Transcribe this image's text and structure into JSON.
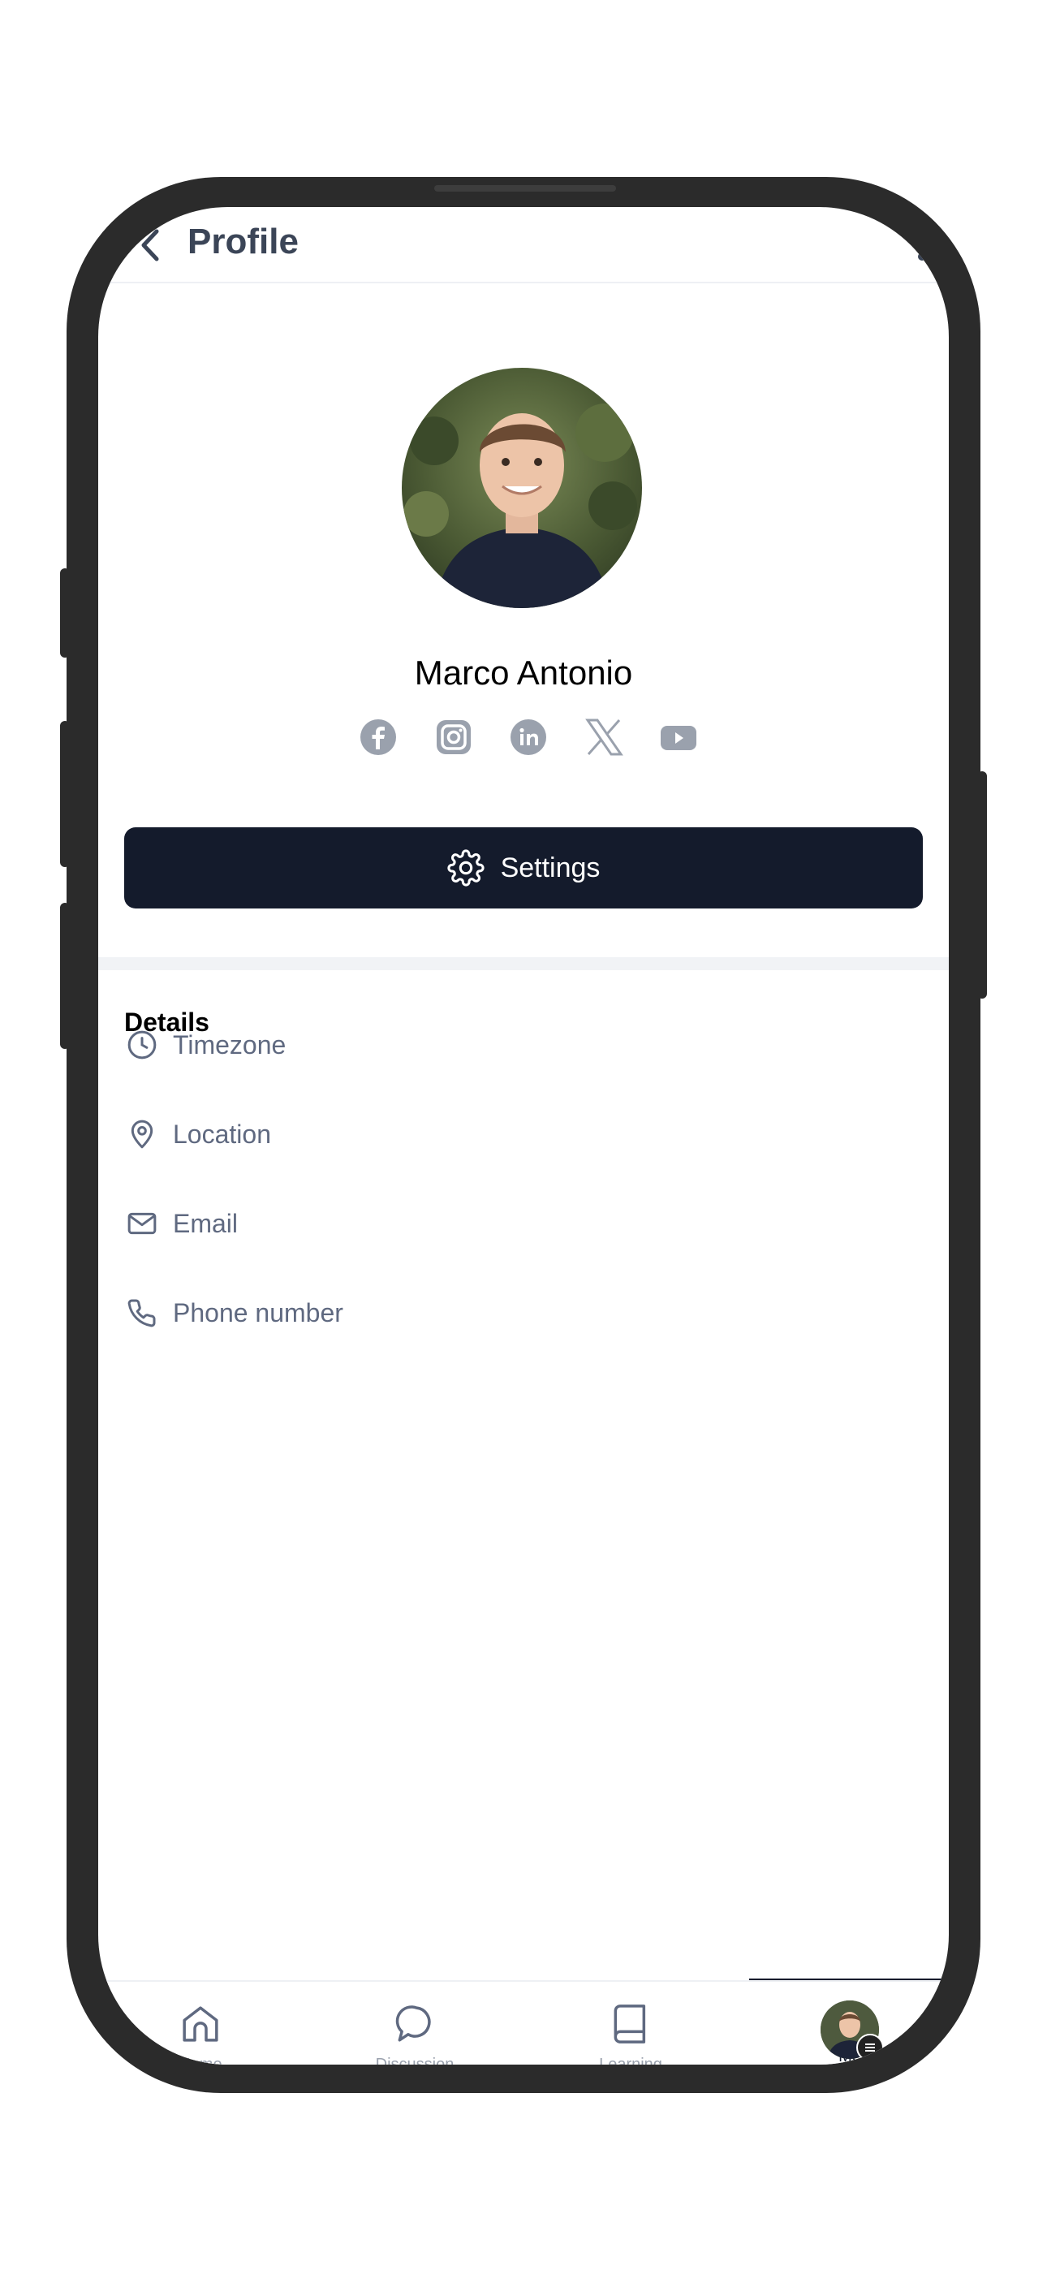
{
  "header": {
    "title": "Profile"
  },
  "profile": {
    "name": "Marco Antonio",
    "socials": [
      "facebook-icon",
      "instagram-icon",
      "linkedin-icon",
      "x-icon",
      "youtube-icon"
    ]
  },
  "settings_button": {
    "label": "Settings"
  },
  "details": {
    "title": "Details",
    "items": [
      {
        "icon": "clock-icon",
        "label": "Timezone"
      },
      {
        "icon": "location-pin-icon",
        "label": "Location"
      },
      {
        "icon": "mail-icon",
        "label": "Email"
      },
      {
        "icon": "phone-icon",
        "label": "Phone number"
      }
    ]
  },
  "tabbar": {
    "tabs": [
      {
        "icon": "home-icon",
        "label": "Home"
      },
      {
        "icon": "discussion-icon",
        "label": "Discussion"
      },
      {
        "icon": "book-icon",
        "label": "Learning"
      },
      {
        "icon": "avatar",
        "label": "Me"
      }
    ],
    "active": "Me"
  },
  "colors": {
    "primary": "#141b2c",
    "muted_text": "#5f6980",
    "icon_gray": "#9aa1ad"
  }
}
